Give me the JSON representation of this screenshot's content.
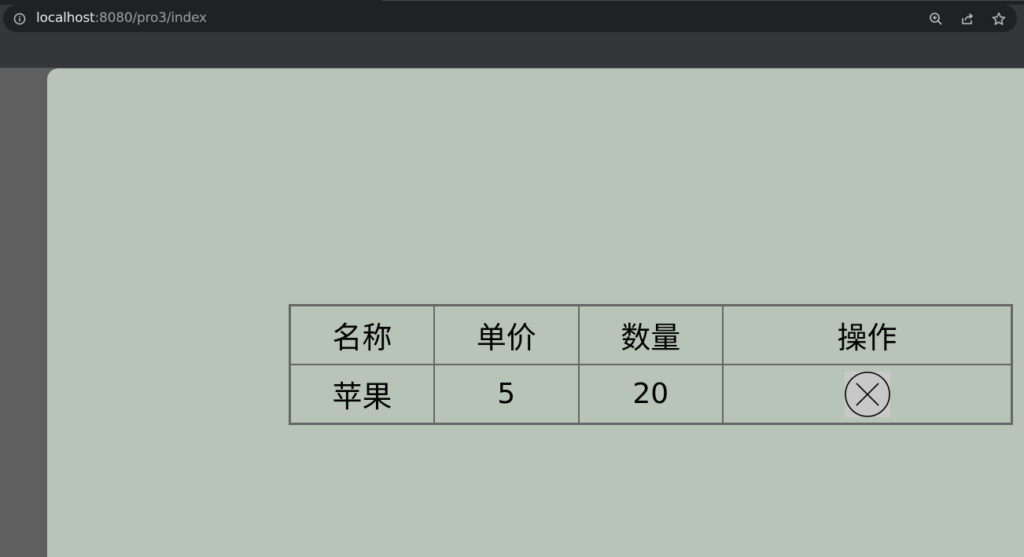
{
  "browser": {
    "url_host": "localhost",
    "url_rest": ":8080/pro3/index",
    "icons": {
      "info": "info-icon",
      "zoom": "zoom-icon",
      "share": "share-icon",
      "bookmark": "star-icon"
    }
  },
  "table": {
    "headers": [
      "名称",
      "单价",
      "数量",
      "操作"
    ],
    "rows": [
      {
        "name": "苹果",
        "price": "5",
        "quantity": "20",
        "action_icon": "delete-icon"
      }
    ]
  },
  "colors": {
    "page_background": "#b8c4b8",
    "table_border": "#666666",
    "browser_chrome": "#35363a"
  }
}
